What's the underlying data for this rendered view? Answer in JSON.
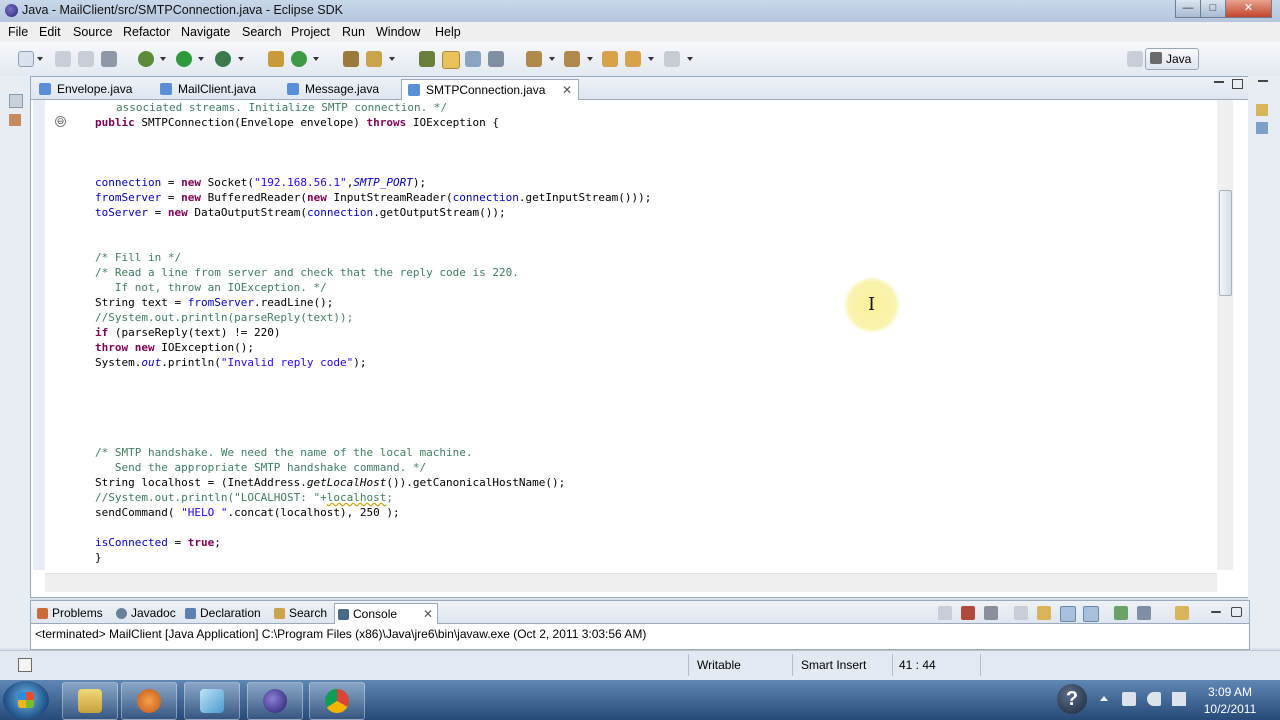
{
  "window": {
    "title": "Java - MailClient/src/SMTPConnection.java - Eclipse SDK",
    "min_glyph": "—",
    "max_glyph": "□",
    "close_glyph": "✕"
  },
  "menu": [
    "File",
    "Edit",
    "Source",
    "Refactor",
    "Navigate",
    "Search",
    "Project",
    "Run",
    "Window",
    "Help"
  ],
  "perspective": {
    "label": "Java"
  },
  "editor": {
    "tabs": [
      {
        "label": "Envelope.java"
      },
      {
        "label": "MailClient.java"
      },
      {
        "label": "Message.java"
      },
      {
        "label": "SMTPConnection.java",
        "close": "✕"
      }
    ],
    "fold_glyph": "⊖",
    "code": {
      "l1": "associated streams. Initialize SMTP connection. */",
      "l2_kw1": "public",
      "l2_rest": " SMTPConnection(Envelope envelope) ",
      "l2_kw2": "throws",
      "l2_end": " IOException {",
      "l3_fd": "connection",
      "l3_a": " = ",
      "l3_kw": "new",
      "l3_b": " Socket(",
      "l3_str": "\"192.168.56.1\"",
      "l3_c": ",",
      "l3_const": "SMTP_PORT",
      "l3_d": ");",
      "l4_fd": "fromServer",
      "l4_a": " = ",
      "l4_kw": "new",
      "l4_b": " BufferedReader(",
      "l4_kw2": "new",
      "l4_c": " InputStreamReader(",
      "l4_fd2": "connection",
      "l4_d": ".getInputStream()));",
      "l5_fd": "toServer",
      "l5_a": " = ",
      "l5_kw": "new",
      "l5_b": " DataOutputStream(",
      "l5_fd2": "connection",
      "l5_c": ".getOutputStream());",
      "c1": "/* Fill in */",
      "c2": "/* Read a line from server and check that the reply code is 220.",
      "c3": "   If not, throw an IOException. */",
      "l6_a": "String text = ",
      "l6_fd": "fromServer",
      "l6_b": ".readLine();",
      "c4": "//System.out.println(parseReply(text));",
      "l7_kw": "if",
      "l7_rest": " (parseReply(text) != 220)",
      "l8_kw": "throw",
      "l8_kw2": "new",
      "l8_rest": " IOException();",
      "l9_a": "System.",
      "l9_out": "out",
      "l9_b": ".println(",
      "l9_str": "\"Invalid reply code\"",
      "l9_c": ");",
      "c5": "/* SMTP handshake. We need the name of the local machine.",
      "c6": "   Send the appropriate SMTP handshake command. */",
      "l10_a": "String localhost = (InetAddress.",
      "l10_it": "getLocalHost",
      "l10_b": "()).getCanonicalHostName();",
      "c7a": "//System.out.println(\"LOCALHOST: \"+",
      "c7b": "localhost",
      "c7c": ";",
      "l11_a": "sendCommand( ",
      "l11_str": "\"HELO \"",
      "l11_b": ".concat(localhost), 250 );",
      "l12_fd": "isConnected",
      "l12_a": " = ",
      "l12_kw": "true",
      "l12_b": ";",
      "l13": "}"
    }
  },
  "console": {
    "tabs": [
      {
        "label": "Problems"
      },
      {
        "label": "Javadoc"
      },
      {
        "label": "Declaration"
      },
      {
        "label": "Search"
      },
      {
        "label": "Console",
        "close": "✕"
      }
    ],
    "line": "<terminated> MailClient [Java Application] C:\\Program Files (x86)\\Java\\jre6\\bin\\javaw.exe (Oct 2, 2011 3:03:56 AM)"
  },
  "status": {
    "writable": "Writable",
    "insert_mode": "Smart Insert",
    "position": "41 : 44"
  },
  "taskbar": {
    "help_glyph": "?",
    "time": "3:09 AM",
    "date": "10/2/2011"
  },
  "cursor_glyph": "I"
}
